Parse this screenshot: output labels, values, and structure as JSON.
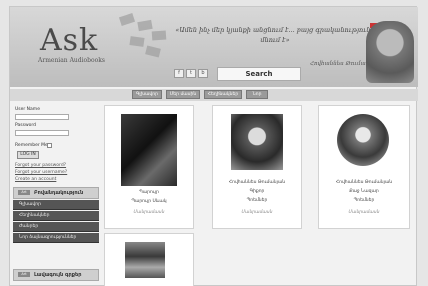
{
  "header": {
    "logo_text": "Ask",
    "logo_subtitle": "Armenian Audiobooks",
    "quote": "«Ամեն ինչ մեր կյանքի անցնում է... բայց գրականությունը մնում է»",
    "author": "Հովհաննես Թումանյան",
    "search_label": "Search",
    "social": [
      "f",
      "t",
      "b"
    ]
  },
  "topnav": {
    "tabs": [
      "Գլխավոր",
      "Մեր մասին",
      "Հեղինակներ",
      "Նոր"
    ]
  },
  "sidebar": {
    "username_label": "User Name",
    "password_label": "Password",
    "remember_label": "Remember Me",
    "login_label": "LOG IN",
    "forgot_password": "Forgot your password?",
    "forgot_username": "Forgot your username?",
    "create_account": "Create an account",
    "menu_heading": "Բովանդակություն",
    "menu_pill": "Art",
    "menu_items": [
      "Գլխավոր",
      "Հեղինակներ",
      "Ժանրեր",
      "Նոր ձայնագրություններ"
    ],
    "bottom_heading": "Լավագույն գրքեր",
    "bottom_pill": "Art"
  },
  "cards": [
    {
      "line1": "Պարույր",
      "line2": "Պարույր Սևակ",
      "more": "Մանրամասն"
    },
    {
      "line1": "Հովհաննես Թումանյան",
      "line2": "Գիքոր",
      "line3": "Պոեմներ",
      "more": "Մանրամասն"
    },
    {
      "line1": "Հովհաննես Թումանյան",
      "line2": "Քաջ Նազար",
      "line3": "Պոեմներ",
      "more": "Մանրամասն"
    },
    {}
  ]
}
